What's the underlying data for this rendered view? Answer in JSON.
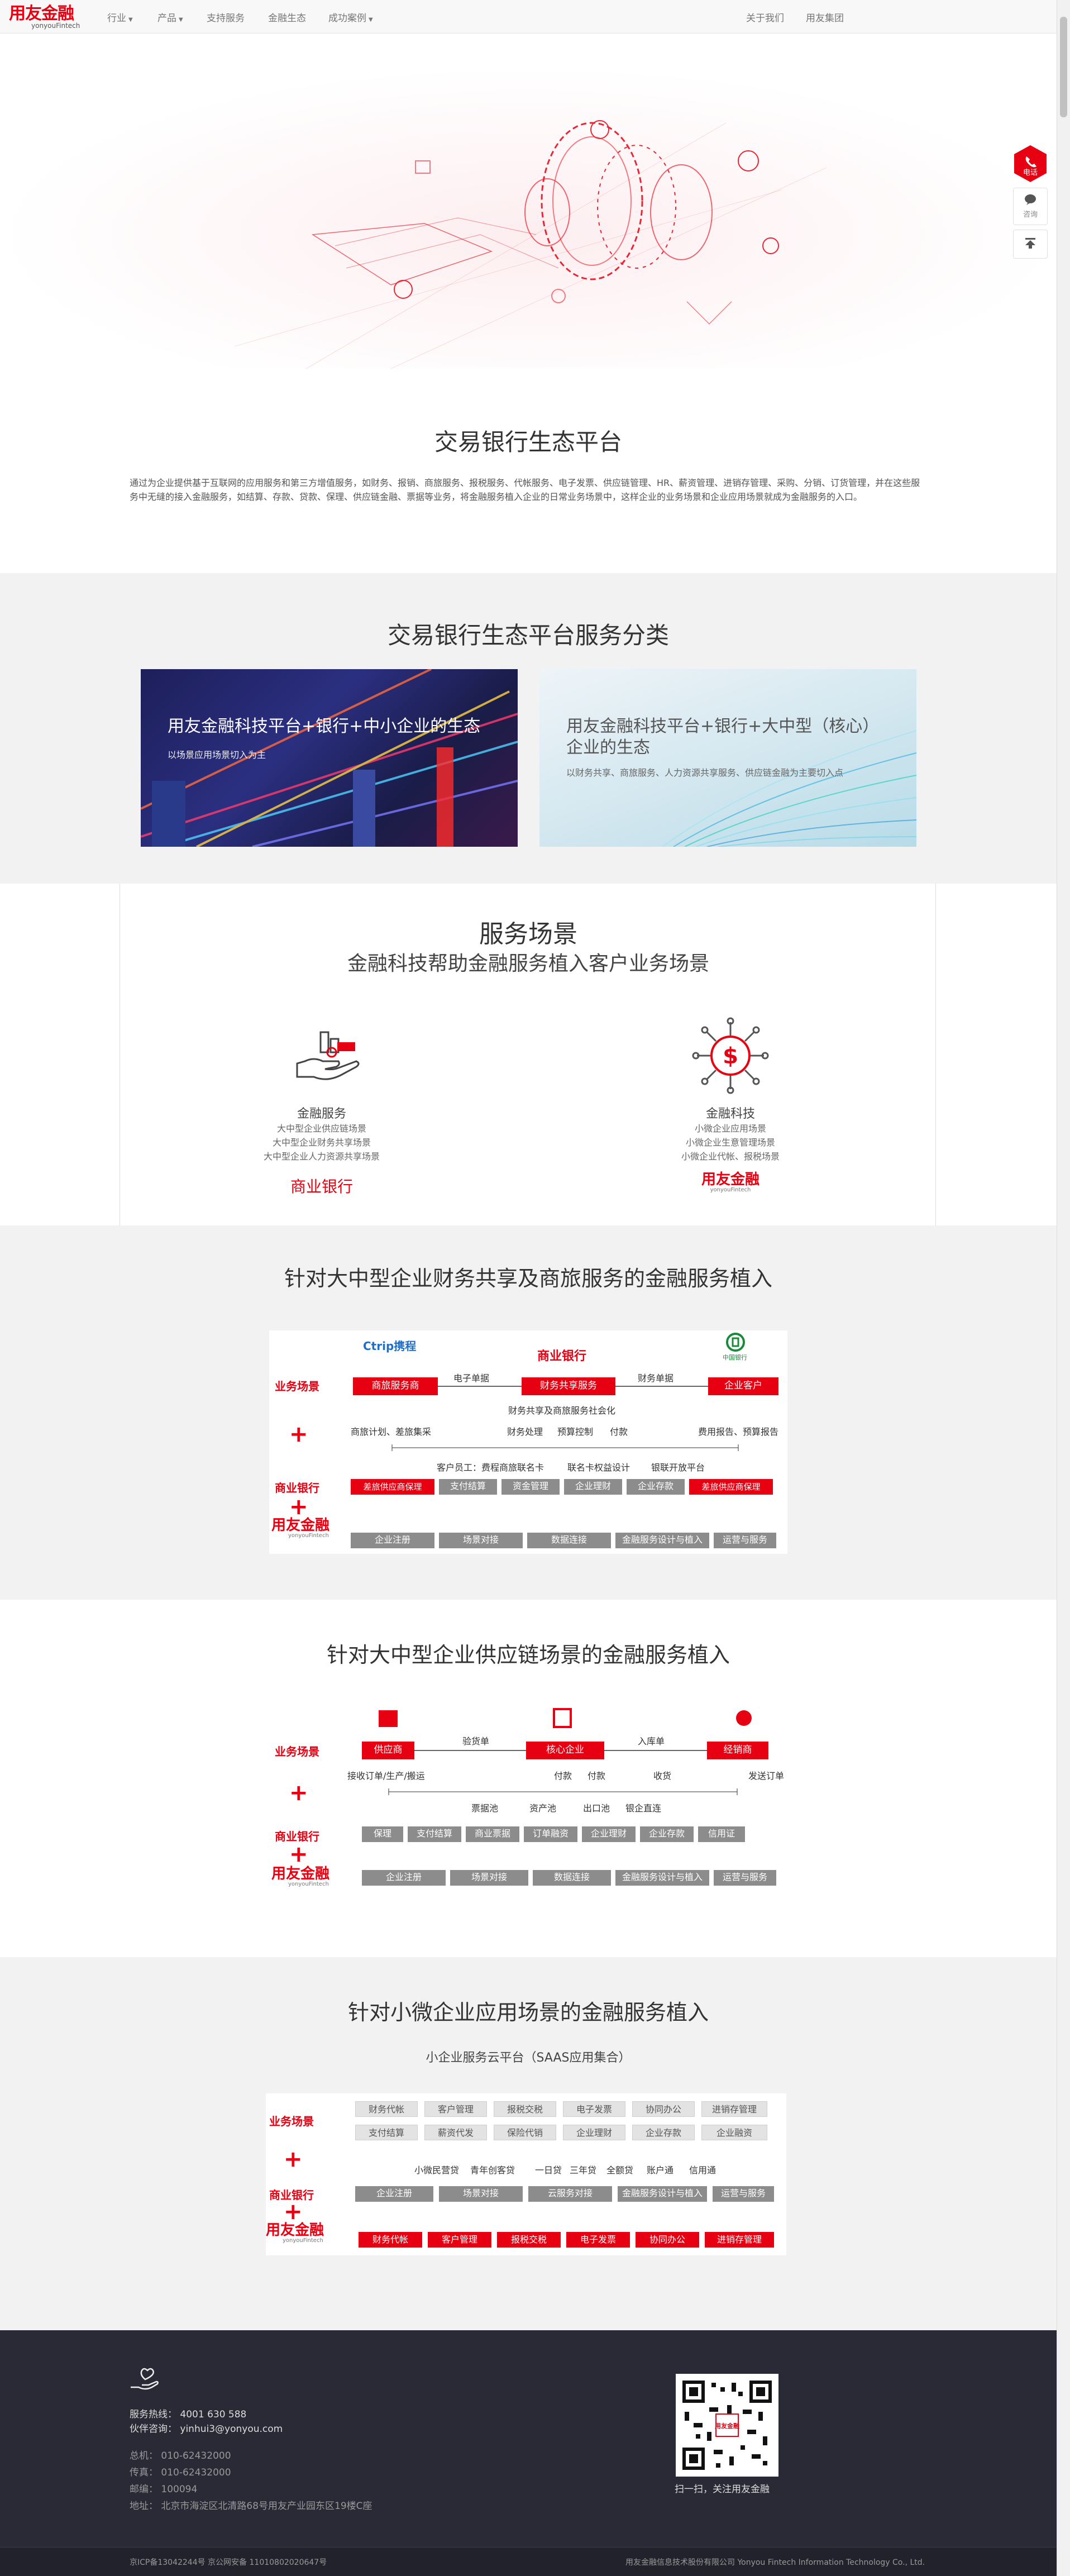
{
  "nav": {
    "logo_text": "用友金融",
    "logo_sub": "yonyouFintech",
    "items": [
      "行业",
      "产品",
      "支持服务",
      "金融生态",
      "成功案例"
    ],
    "right": [
      "关于我们",
      "用友集团"
    ]
  },
  "floating": {
    "call": "电话",
    "consult": "咨询"
  },
  "intro": {
    "title": "交易银行生态平台",
    "text": "通过为企业提供基于互联网的应用服务和第三方增值服务，如财务、报销、商旅服务、报税服务、代帐服务、电子发票、供应链管理、HR、薪资管理、进销存管理、采购、分销、订货管理，并在这些服务中无缝的接入金融服务，如结算、存款、贷款、保理、供应链金融、票据等业务，将金融服务植入企业的日常业务场景中，这样企业的业务场景和企业应用场景就成为金融服务的入口。"
  },
  "category": {
    "title": "交易银行生态平台服务分类",
    "cards": [
      {
        "title": "用友金融科技平台+银行+中小企业的生态",
        "sub": "以场景应用场景切入为主"
      },
      {
        "title": "用友金融科技平台+银行+大中型（核心）企业的生态",
        "sub": "以财务共享、商旅服务、人力资源共享服务、供应链金融为主要切入点"
      }
    ]
  },
  "scenes": {
    "title": "服务场景",
    "subtitle": "金融科技帮助金融服务植入客户业务场景",
    "left": {
      "name": "金融服务",
      "lines": [
        "大中型企业供应链场景",
        "大中型企业财务共享场景",
        "大中型企业人力资源共享场景"
      ],
      "bank": "商业银行"
    },
    "right": {
      "name": "金融科技",
      "lines": [
        "小微企业应用场景",
        "小微企业生意管理场景",
        "小微企业代帐、报税场景"
      ],
      "brand": "用友金融",
      "brand_sub": "yonyouFintech"
    }
  },
  "labels": {
    "scene": "业务场景",
    "bank": "商业银行",
    "plus": "+",
    "brand": "用友金融",
    "brand_sub": "yonyouFintech"
  },
  "d1": {
    "title": "针对大中型企业财务共享及商旅服务的金融服务植入",
    "ctrip": "Ctrip携程",
    "bank_top": "商业银行",
    "cbank": "中国银行",
    "boxes": [
      "商旅服务商",
      "财务共享服务",
      "企业客户"
    ],
    "arrows": [
      "电子单据",
      "财务单据"
    ],
    "mid": "财务共享及商旅服务社会化",
    "row1_left": "商旅计划、差旅集采",
    "row1_mid": [
      "财务处理",
      "预算控制",
      "付款"
    ],
    "row1_right": "费用报告、预算报告",
    "row2": [
      "客户员工：费程商旅联名卡",
      "联名卡权益设计",
      "银联开放平台"
    ],
    "bank_row": [
      "差旅供应商保理",
      "支付结算",
      "资金管理",
      "企业理财",
      "企业存款",
      "差旅供应商保理"
    ],
    "brand_row": [
      "企业注册",
      "场景对接",
      "数据连接",
      "金融服务设计与植入",
      "运营与服务"
    ]
  },
  "d2": {
    "title": "针对大中型企业供应链场景的金融服务植入",
    "boxes": [
      "供应商",
      "核心企业",
      "经销商"
    ],
    "arrows": [
      "验货单",
      "入库单"
    ],
    "row1": [
      "接收订单/生产/搬运",
      "付款",
      "付款",
      "收货",
      "发送订单"
    ],
    "row2": [
      "票据池",
      "资产池",
      "出口池",
      "银企直连"
    ],
    "bank_row": [
      "保理",
      "支付结算",
      "商业票据",
      "订单融资",
      "企业理财",
      "企业存款",
      "信用证"
    ],
    "brand_row": [
      "企业注册",
      "场景对接",
      "数据连接",
      "金融服务设计与植入",
      "运营与服务"
    ]
  },
  "d3": {
    "title": "针对小微企业应用场景的金融服务植入",
    "subtitle": "小企业服务云平台（SAAS应用集合）",
    "grid1": [
      "财务代帐",
      "客户管理",
      "报税交税",
      "电子发票",
      "协同办公",
      "进销存管理"
    ],
    "grid2": [
      "支付结算",
      "薪资代发",
      "保险代销",
      "企业理财",
      "企业存款",
      "企业融资"
    ],
    "loans": [
      "小微民营贷",
      "青年创客贷",
      "一日贷",
      "三年贷",
      "全额贷",
      "账户通",
      "信用通"
    ],
    "bank_row": [
      "企业注册",
      "场景对接",
      "云服务对接",
      "金融服务设计与植入",
      "运营与服务"
    ],
    "brand_row": [
      "财务代帐",
      "客户管理",
      "报税交税",
      "电子发票",
      "协同办公",
      "进销存管理"
    ]
  },
  "footer": {
    "hotline": "服务热线：  4001 630 588",
    "partner": "伙伴咨询：  yinhui3@yonyou.com",
    "lines": [
      "总机：    010-62432000",
      "传真：    010-62432000",
      "邮编：    100094",
      "地址：    北京市海淀区北清路68号用友产业园东区19楼C座"
    ],
    "qr_caption": "扫一扫，关注用友金融",
    "icp": "京ICP备13042244号  京公网安备 11010802020647号",
    "company": "用友金融信息技术股份有限公司 Yonyou Fintech Information Technology Co., Ltd."
  },
  "colors": {
    "brand_red": "#e60012",
    "gray_box": "#8c8c8c",
    "footer_bg": "#2a2a37"
  }
}
